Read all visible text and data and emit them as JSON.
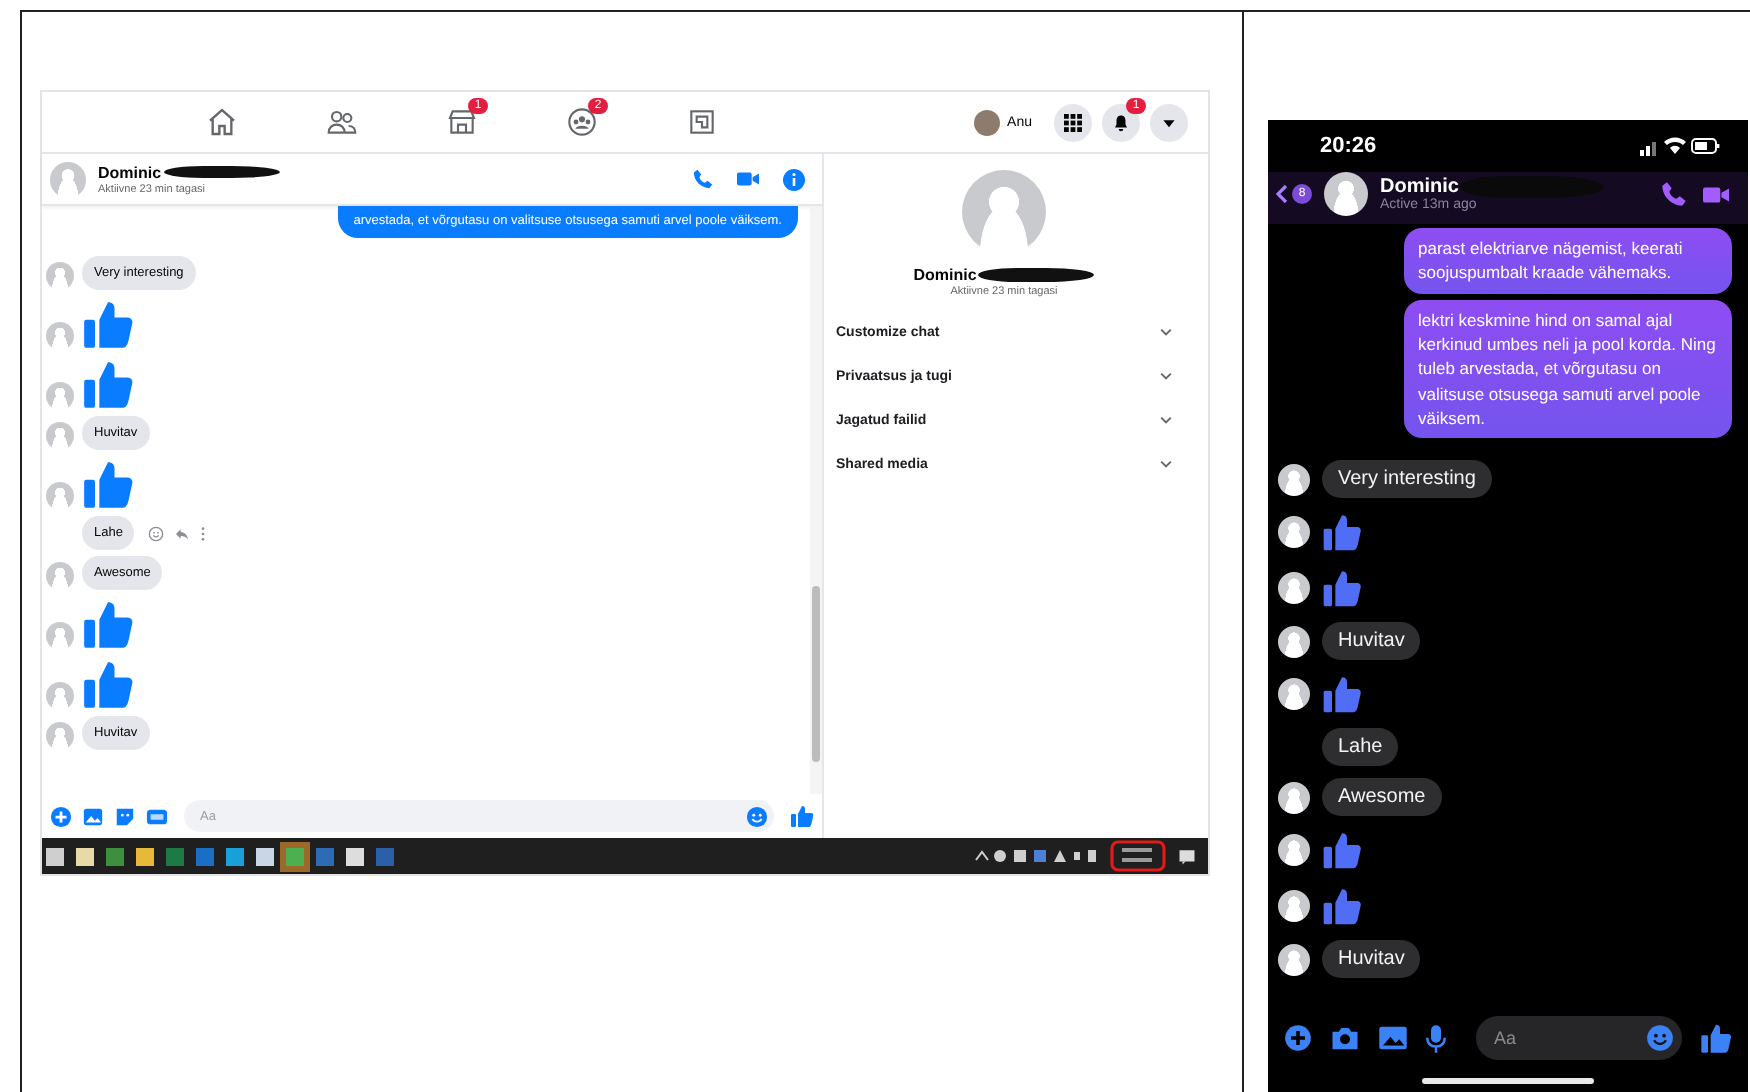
{
  "desktop": {
    "nav": [
      {
        "kind": "home"
      },
      {
        "kind": "people"
      },
      {
        "kind": "store",
        "badge": "1"
      },
      {
        "kind": "groups",
        "badge": "2"
      },
      {
        "kind": "gaming"
      }
    ],
    "account": {
      "name": "Anu",
      "notifications": "1"
    },
    "chat": {
      "name": "Dominic",
      "status": "Aktiivne 23 min tagasi",
      "messages": [
        {
          "kind": "sent",
          "text": "arvestada, et võrgutasu on valitsuse otsusega samuti arvel poole väiksem."
        },
        {
          "kind": "text",
          "text": "Very interesting",
          "avatar": true,
          "hovered": false
        },
        {
          "kind": "like",
          "avatar": true
        },
        {
          "kind": "like",
          "avatar": true
        },
        {
          "kind": "text",
          "text": "Huvitav",
          "avatar": true,
          "hovered": false
        },
        {
          "kind": "like",
          "avatar": true
        },
        {
          "kind": "text",
          "text": "Lahe",
          "avatar": false,
          "hovered": true
        },
        {
          "kind": "text",
          "text": "Awesome",
          "avatar": true,
          "hovered": false
        },
        {
          "kind": "like",
          "avatar": true
        },
        {
          "kind": "like",
          "avatar": true
        },
        {
          "kind": "text",
          "text": "Huvitav",
          "avatar": true,
          "hovered": false
        }
      ]
    },
    "info": {
      "name": "Dominic",
      "status": "Aktiivne 23 min tagasi",
      "sections": [
        "Customize chat",
        "Privaatsus ja tugi",
        "Jagatud failid",
        "Shared media"
      ]
    },
    "composer": {
      "placeholder": "Aa"
    }
  },
  "phone": {
    "time": "20:26",
    "back_badge": "8",
    "chat": {
      "name": "Dominic",
      "status": "Active 13m ago",
      "messages": [
        {
          "kind": "sent",
          "text": "parast elektriarve nägemist, keerati soojuspumbalt kraade vähemaks."
        },
        {
          "kind": "sent",
          "text": "lektri keskmine hind on samal ajal kerkinud umbes neli ja pool korda. Ning tuleb arvestada, et võrgutasu on valitsuse otsusega samuti arvel poole väiksem."
        },
        {
          "kind": "text",
          "text": "Very interesting",
          "avatar": true
        },
        {
          "kind": "like",
          "avatar": true
        },
        {
          "kind": "like",
          "avatar": true
        },
        {
          "kind": "text",
          "text": "Huvitav",
          "avatar": true
        },
        {
          "kind": "like",
          "avatar": true
        },
        {
          "kind": "text",
          "text": "Lahe",
          "avatar": false
        },
        {
          "kind": "text",
          "text": "Awesome",
          "avatar": true
        },
        {
          "kind": "like",
          "avatar": true
        },
        {
          "kind": "like",
          "avatar": true
        },
        {
          "kind": "text",
          "text": "Huvitav",
          "avatar": true
        }
      ]
    },
    "composer": {
      "placeholder": "Aa"
    }
  }
}
